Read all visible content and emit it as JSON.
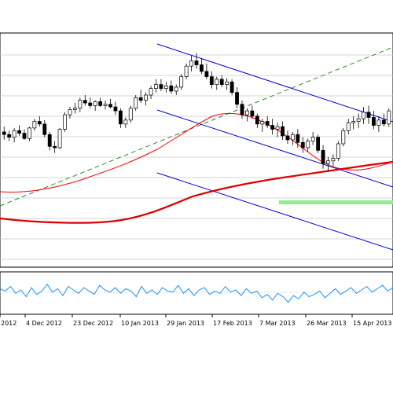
{
  "chart_data": {
    "type": "candlestick",
    "x_tick_labels": [
      "2012",
      "4 Dec 2012",
      "23 Dec 2012",
      "10 Jan 2013",
      "29 Jan 2013",
      "17 Feb 2013",
      "7 Mar 2013",
      "26 Mar 2013",
      "15 Apr 2013"
    ],
    "price_panel": {
      "y_range": [
        0,
        100
      ],
      "grid": true,
      "candles": [
        {
          "o": 52,
          "h": 56,
          "l": 46,
          "c": 50
        },
        {
          "o": 50,
          "h": 53,
          "l": 45,
          "c": 48
        },
        {
          "o": 48,
          "h": 55,
          "l": 44,
          "c": 53
        },
        {
          "o": 53,
          "h": 57,
          "l": 49,
          "c": 51
        },
        {
          "o": 51,
          "h": 54,
          "l": 46,
          "c": 47
        },
        {
          "o": 47,
          "h": 56,
          "l": 45,
          "c": 55
        },
        {
          "o": 55,
          "h": 62,
          "l": 53,
          "c": 60
        },
        {
          "o": 60,
          "h": 64,
          "l": 56,
          "c": 58
        },
        {
          "o": 58,
          "h": 61,
          "l": 48,
          "c": 50
        },
        {
          "o": 50,
          "h": 52,
          "l": 38,
          "c": 41
        },
        {
          "o": 41,
          "h": 45,
          "l": 36,
          "c": 40
        },
        {
          "o": 40,
          "h": 55,
          "l": 39,
          "c": 54
        },
        {
          "o": 54,
          "h": 67,
          "l": 52,
          "c": 65
        },
        {
          "o": 65,
          "h": 71,
          "l": 62,
          "c": 69
        },
        {
          "o": 69,
          "h": 74,
          "l": 66,
          "c": 70
        },
        {
          "o": 70,
          "h": 78,
          "l": 67,
          "c": 76
        },
        {
          "o": 76,
          "h": 80,
          "l": 72,
          "c": 74
        },
        {
          "o": 74,
          "h": 78,
          "l": 70,
          "c": 72
        },
        {
          "o": 72,
          "h": 76,
          "l": 68,
          "c": 75
        },
        {
          "o": 75,
          "h": 78,
          "l": 71,
          "c": 72
        },
        {
          "o": 72,
          "h": 76,
          "l": 69,
          "c": 73
        },
        {
          "o": 73,
          "h": 77,
          "l": 70,
          "c": 71
        },
        {
          "o": 71,
          "h": 75,
          "l": 65,
          "c": 68
        },
        {
          "o": 68,
          "h": 70,
          "l": 55,
          "c": 58
        },
        {
          "o": 58,
          "h": 63,
          "l": 55,
          "c": 61
        },
        {
          "o": 61,
          "h": 72,
          "l": 59,
          "c": 70
        },
        {
          "o": 70,
          "h": 80,
          "l": 68,
          "c": 78
        },
        {
          "o": 78,
          "h": 84,
          "l": 74,
          "c": 76
        },
        {
          "o": 76,
          "h": 82,
          "l": 72,
          "c": 80
        },
        {
          "o": 80,
          "h": 87,
          "l": 77,
          "c": 85
        },
        {
          "o": 85,
          "h": 92,
          "l": 82,
          "c": 88
        },
        {
          "o": 88,
          "h": 92,
          "l": 83,
          "c": 85
        },
        {
          "o": 85,
          "h": 90,
          "l": 82,
          "c": 87
        },
        {
          "o": 87,
          "h": 91,
          "l": 81,
          "c": 83
        },
        {
          "o": 83,
          "h": 88,
          "l": 80,
          "c": 86
        },
        {
          "o": 86,
          "h": 96,
          "l": 84,
          "c": 94
        },
        {
          "o": 94,
          "h": 104,
          "l": 92,
          "c": 102
        },
        {
          "o": 102,
          "h": 110,
          "l": 98,
          "c": 106
        },
        {
          "o": 106,
          "h": 112,
          "l": 100,
          "c": 103
        },
        {
          "o": 103,
          "h": 108,
          "l": 96,
          "c": 98
        },
        {
          "o": 98,
          "h": 104,
          "l": 92,
          "c": 94
        },
        {
          "o": 94,
          "h": 98,
          "l": 85,
          "c": 88
        },
        {
          "o": 88,
          "h": 94,
          "l": 84,
          "c": 92
        },
        {
          "o": 92,
          "h": 95,
          "l": 86,
          "c": 88
        },
        {
          "o": 88,
          "h": 93,
          "l": 84,
          "c": 90
        },
        {
          "o": 90,
          "h": 92,
          "l": 80,
          "c": 82
        },
        {
          "o": 82,
          "h": 86,
          "l": 70,
          "c": 73
        },
        {
          "o": 73,
          "h": 76,
          "l": 62,
          "c": 65
        },
        {
          "o": 65,
          "h": 70,
          "l": 60,
          "c": 68
        },
        {
          "o": 68,
          "h": 72,
          "l": 62,
          "c": 64
        },
        {
          "o": 64,
          "h": 66,
          "l": 55,
          "c": 58
        },
        {
          "o": 58,
          "h": 62,
          "l": 52,
          "c": 60
        },
        {
          "o": 60,
          "h": 64,
          "l": 55,
          "c": 57
        },
        {
          "o": 57,
          "h": 62,
          "l": 50,
          "c": 54
        },
        {
          "o": 54,
          "h": 59,
          "l": 48,
          "c": 56
        },
        {
          "o": 56,
          "h": 60,
          "l": 46,
          "c": 49
        },
        {
          "o": 49,
          "h": 53,
          "l": 43,
          "c": 46
        },
        {
          "o": 46,
          "h": 52,
          "l": 42,
          "c": 50
        },
        {
          "o": 50,
          "h": 54,
          "l": 40,
          "c": 44
        },
        {
          "o": 44,
          "h": 48,
          "l": 36,
          "c": 40
        },
        {
          "o": 40,
          "h": 47,
          "l": 37,
          "c": 45
        },
        {
          "o": 45,
          "h": 52,
          "l": 42,
          "c": 48
        },
        {
          "o": 48,
          "h": 50,
          "l": 36,
          "c": 38
        },
        {
          "o": 38,
          "h": 42,
          "l": 24,
          "c": 28
        },
        {
          "o": 28,
          "h": 33,
          "l": 22,
          "c": 30
        },
        {
          "o": 30,
          "h": 35,
          "l": 26,
          "c": 32
        },
        {
          "o": 32,
          "h": 45,
          "l": 30,
          "c": 43
        },
        {
          "o": 43,
          "h": 55,
          "l": 41,
          "c": 53
        },
        {
          "o": 53,
          "h": 62,
          "l": 50,
          "c": 59
        },
        {
          "o": 59,
          "h": 64,
          "l": 54,
          "c": 60
        },
        {
          "o": 60,
          "h": 66,
          "l": 55,
          "c": 62
        },
        {
          "o": 62,
          "h": 71,
          "l": 58,
          "c": 67
        },
        {
          "o": 67,
          "h": 72,
          "l": 58,
          "c": 63
        },
        {
          "o": 63,
          "h": 68,
          "l": 54,
          "c": 57
        },
        {
          "o": 57,
          "h": 64,
          "l": 52,
          "c": 61
        },
        {
          "o": 61,
          "h": 66,
          "l": 56,
          "c": 58
        },
        {
          "o": 58,
          "h": 70,
          "l": 56,
          "c": 68
        }
      ],
      "ma_fast_color": "#ff0000",
      "ma_slow_color": "#dd0000",
      "trend_channel_color": "#0000dd",
      "trendline_color": "#228b22",
      "support_band_color": "#90ee90"
    },
    "oscillator_panel": {
      "line_color": "#1e90ff",
      "values": [
        62,
        60,
        64,
        58,
        61,
        55,
        63,
        57,
        60,
        66,
        59,
        62,
        56,
        64,
        61,
        58,
        63,
        60,
        57,
        65,
        61,
        59,
        63,
        58,
        62,
        60,
        55,
        64,
        58,
        61,
        57,
        63,
        60,
        59,
        65,
        58,
        62,
        56,
        61,
        63,
        57,
        60,
        58,
        64,
        59,
        61,
        56,
        62,
        58,
        60,
        54,
        57,
        52,
        58,
        55,
        50,
        56,
        53,
        59,
        55,
        57,
        60,
        54,
        58,
        62,
        57,
        60,
        63,
        58,
        61,
        64,
        59,
        62,
        65,
        60,
        63
      ]
    },
    "grid": true,
    "legend": "none"
  }
}
